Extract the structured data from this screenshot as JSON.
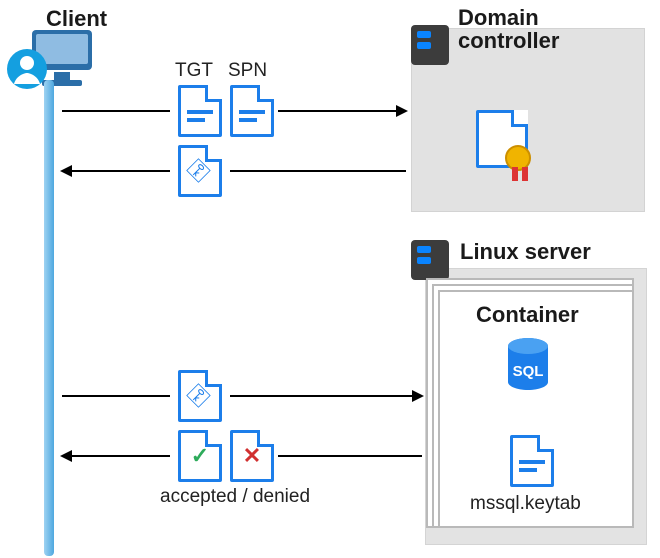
{
  "title": "Kerberos authentication flow for SQL Server on Linux container",
  "client": {
    "label": "Client"
  },
  "domain_controller": {
    "label_line1": "Domain",
    "label_line2": "controller"
  },
  "linux_server": {
    "label": "Linux server"
  },
  "container": {
    "label": "Container",
    "keytab_file": "mssql.keytab",
    "service": "SQL"
  },
  "tickets": {
    "tgt": "TGT",
    "spn": "SPN"
  },
  "result": {
    "text": "accepted / denied"
  },
  "icons": {
    "monitor": "client-monitor-icon",
    "user": "client-user-icon",
    "rack": "server-rack-icon",
    "doc": "document-icon",
    "key": "key-document-icon",
    "cert": "certificate-icon",
    "check": "check-document-icon",
    "cross": "cross-document-icon",
    "sql": "sql-database-icon"
  },
  "flows": [
    {
      "from": "Client",
      "to": "Domain controller",
      "payload": [
        "TGT",
        "SPN"
      ]
    },
    {
      "from": "Domain controller",
      "to": "Client",
      "payload": [
        "service-ticket-key"
      ]
    },
    {
      "from": "Client",
      "to": "Linux server / Container",
      "payload": [
        "service-ticket-key"
      ]
    },
    {
      "from": "Linux server / Container",
      "to": "Client",
      "payload": [
        "accepted",
        "denied"
      ]
    }
  ]
}
